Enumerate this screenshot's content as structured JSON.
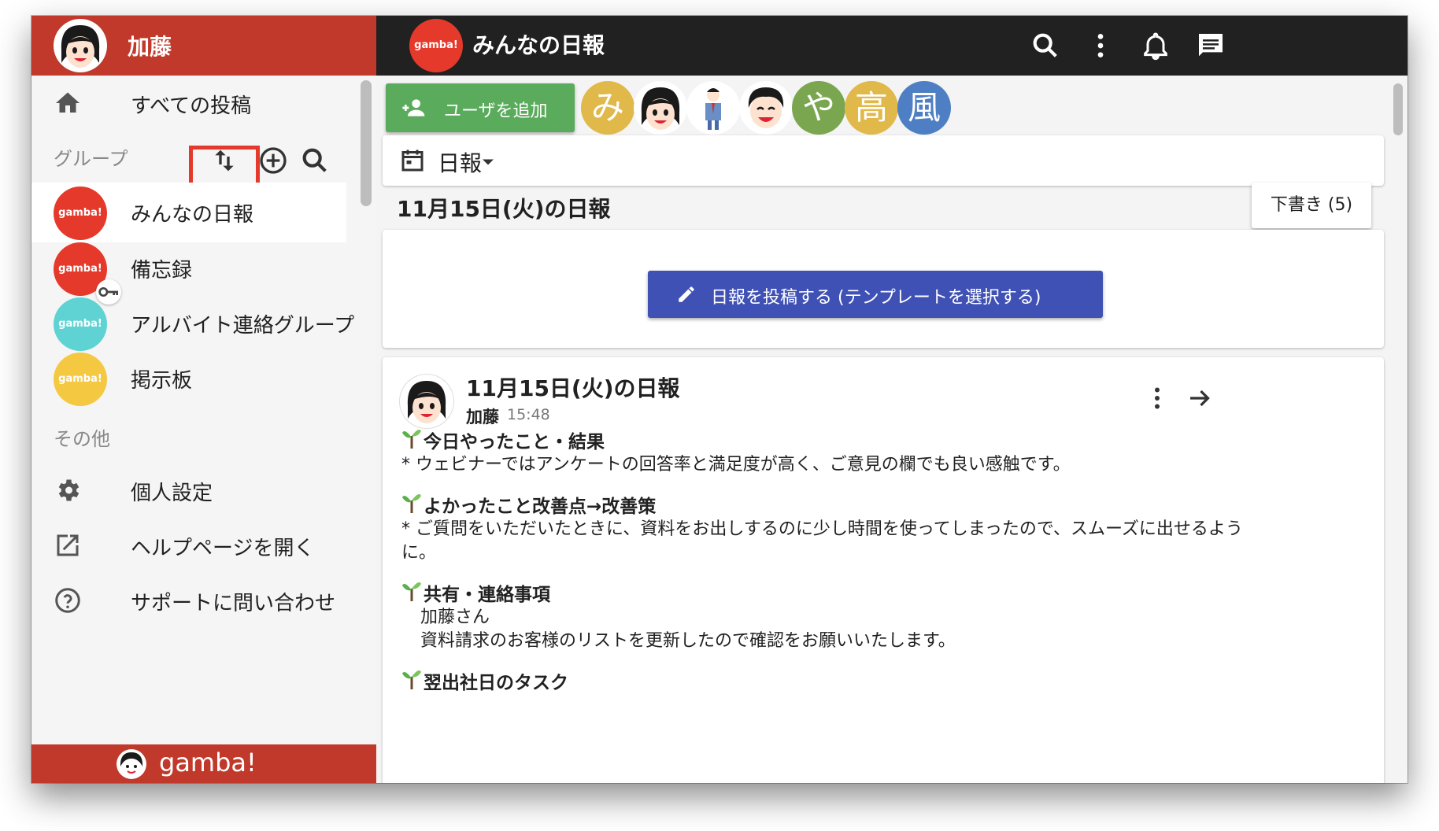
{
  "sidebar": {
    "user_name": "加藤",
    "nav_all_posts": "すべての投稿",
    "groups_label": "グループ",
    "groups": [
      {
        "name": "みんなの日報",
        "logo": "gamba!",
        "color": "#e53a2b"
      },
      {
        "name": "備忘録",
        "logo": "gamba!",
        "color": "#e53a2b"
      },
      {
        "name": "アルバイト連絡グループ",
        "logo": "gamba!",
        "color": "#5fd3d3"
      },
      {
        "name": "掲示板",
        "logo": "gamba!",
        "color": "#f5c842"
      }
    ],
    "other_label": "その他",
    "settings": "個人設定",
    "help": "ヘルプページを開く",
    "support": "サポートに問い合わせ",
    "footer_brand": "gamba!"
  },
  "topbar": {
    "logo": "gamba!",
    "title": "みんなの日報",
    "icons": [
      "search-icon",
      "more-vert-icon",
      "bell-icon",
      "chat-icon"
    ]
  },
  "main": {
    "add_user_label": "ユーザを追加",
    "members": [
      {
        "initial": "み",
        "color": "#e0b94a"
      },
      {
        "initial": "",
        "color": "#ffffff"
      },
      {
        "initial": "",
        "color": "#ffffff"
      },
      {
        "initial": "",
        "color": "#ffffff"
      },
      {
        "initial": "や",
        "color": "#7aa64f"
      },
      {
        "initial": "高",
        "color": "#e0b94a"
      },
      {
        "initial": "風",
        "color": "#4e7fc4"
      }
    ],
    "report_type": "日報",
    "date_heading": "11月15日(火)の日報",
    "draft_label": "下書き (5)",
    "post_button": "日報を投稿する (テンプレートを選択する)"
  },
  "report": {
    "title": "11月15日(火)の日報",
    "author": "加藤",
    "time": "15:48",
    "sections": [
      {
        "heading": "今日やったこと・結果",
        "lines": [
          "* ウェビナーではアンケートの回答率と満足度が高く、ご意見の欄でも良い感触です。"
        ]
      },
      {
        "heading": "よかったこと改善点→改善策",
        "lines": [
          "* ご質問をいただいたときに、資料をお出しするのに少し時間を使ってしまったので、スムーズに出せるよう",
          "に。"
        ]
      },
      {
        "heading": "共有・連絡事項",
        "lines": [
          "加藤さん",
          "資料請求のお客様のリストを更新したので確認をお願いいたします。"
        ]
      },
      {
        "heading": "翌出社日のタスク",
        "lines": []
      }
    ]
  },
  "colors": {
    "brand_red": "#c0392b",
    "topbar": "#212121",
    "add_green": "#5aab5c",
    "post_blue": "#3f51b5",
    "highlight": "#e53a2b"
  }
}
